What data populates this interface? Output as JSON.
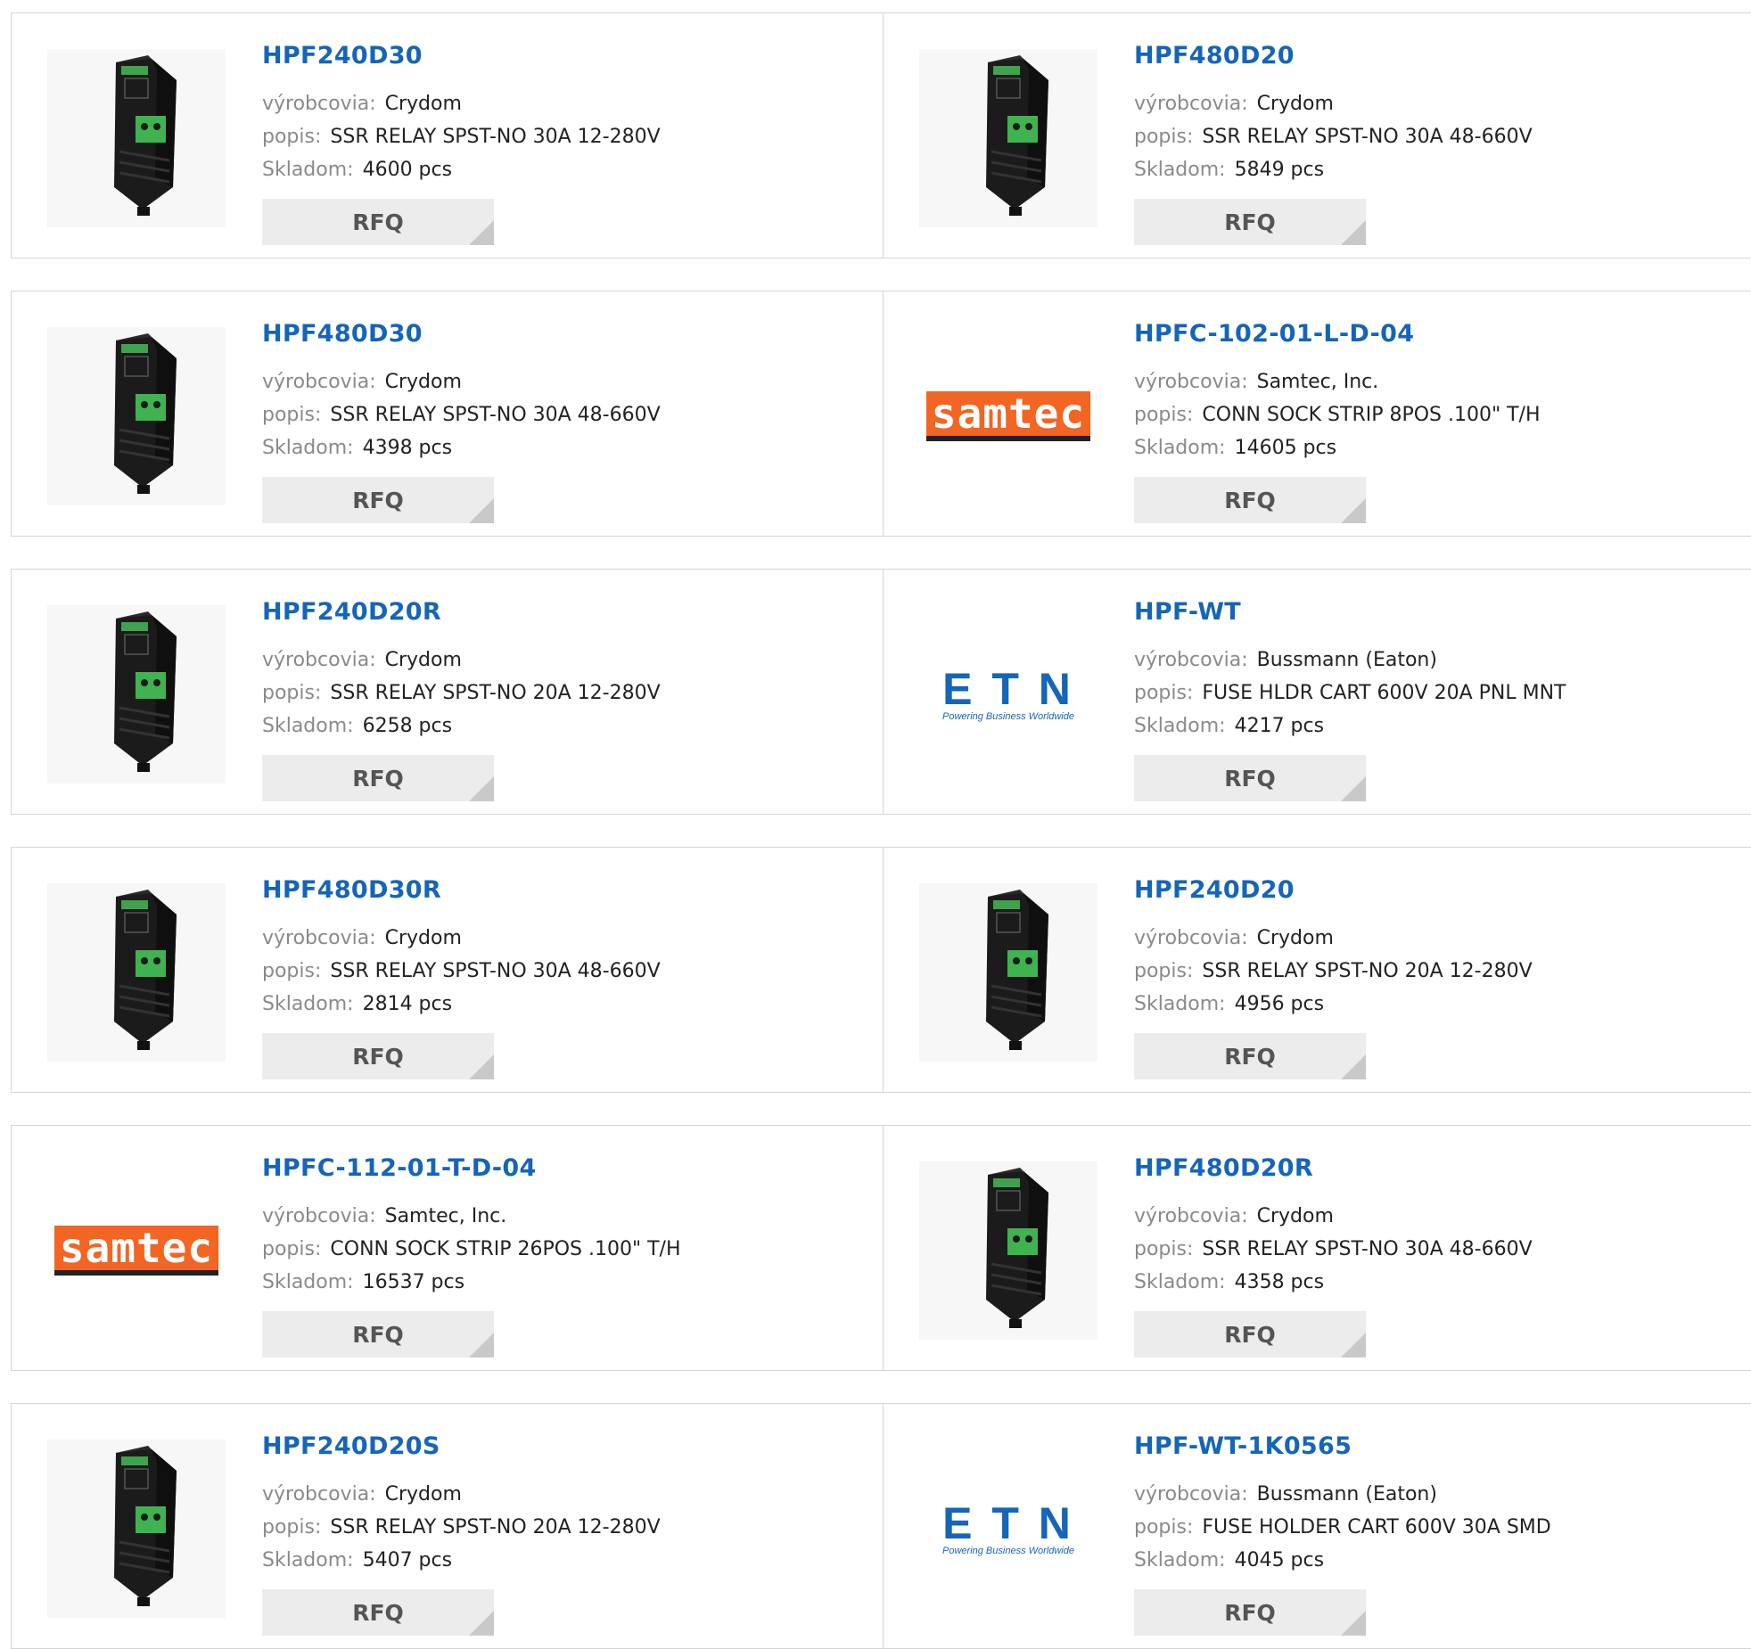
{
  "labels": {
    "manufacturer": "výrobcovia:",
    "description": "popis:",
    "stock": "Skladom:",
    "rfq": "RFQ"
  },
  "logos": {
    "samtec": "samtec",
    "eaton": "E T N",
    "eaton_tagline": "Powering Business Worldwide"
  },
  "colors": {
    "part_link": "#1565b8",
    "samtec_orange": "#f26522",
    "eaton_blue": "#1565b8"
  },
  "products": [
    {
      "part": "HPF240D30",
      "manufacturer": "Crydom",
      "description": "SSR RELAY SPST-NO 30A 12-280V",
      "stock": "4600 pcs",
      "image": "relay"
    },
    {
      "part": "HPF480D20",
      "manufacturer": "Crydom",
      "description": "SSR RELAY SPST-NO 30A 48-660V",
      "stock": "5849 pcs",
      "image": "relay"
    },
    {
      "part": "HPF480D30",
      "manufacturer": "Crydom",
      "description": "SSR RELAY SPST-NO 30A 48-660V",
      "stock": "4398 pcs",
      "image": "relay"
    },
    {
      "part": "HPFC-102-01-L-D-04",
      "manufacturer": "Samtec, Inc.",
      "description": "CONN SOCK STRIP 8POS .100\" T/H",
      "stock": "14605 pcs",
      "image": "samtec"
    },
    {
      "part": "HPF240D20R",
      "manufacturer": "Crydom",
      "description": "SSR RELAY SPST-NO 20A 12-280V",
      "stock": "6258 pcs",
      "image": "relay"
    },
    {
      "part": "HPF-WT",
      "manufacturer": "Bussmann (Eaton)",
      "description": "FUSE HLDR CART 600V 20A PNL MNT",
      "stock": "4217 pcs",
      "image": "eaton"
    },
    {
      "part": "HPF480D30R",
      "manufacturer": "Crydom",
      "description": "SSR RELAY SPST-NO 30A 48-660V",
      "stock": "2814 pcs",
      "image": "relay"
    },
    {
      "part": "HPF240D20",
      "manufacturer": "Crydom",
      "description": "SSR RELAY SPST-NO 20A 12-280V",
      "stock": "4956 pcs",
      "image": "relay"
    },
    {
      "part": "HPFC-112-01-T-D-04",
      "manufacturer": "Samtec, Inc.",
      "description": "CONN SOCK STRIP 26POS .100\" T/H",
      "stock": "16537 pcs",
      "image": "samtec"
    },
    {
      "part": "HPF480D20R",
      "manufacturer": "Crydom",
      "description": "SSR RELAY SPST-NO 30A 48-660V",
      "stock": "4358 pcs",
      "image": "relay"
    },
    {
      "part": "HPF240D20S",
      "manufacturer": "Crydom",
      "description": "SSR RELAY SPST-NO 20A 12-280V",
      "stock": "5407 pcs",
      "image": "relay"
    },
    {
      "part": "HPF-WT-1K0565",
      "manufacturer": "Bussmann (Eaton)",
      "description": "FUSE HOLDER CART 600V 30A SMD",
      "stock": "4045 pcs",
      "image": "eaton"
    }
  ]
}
